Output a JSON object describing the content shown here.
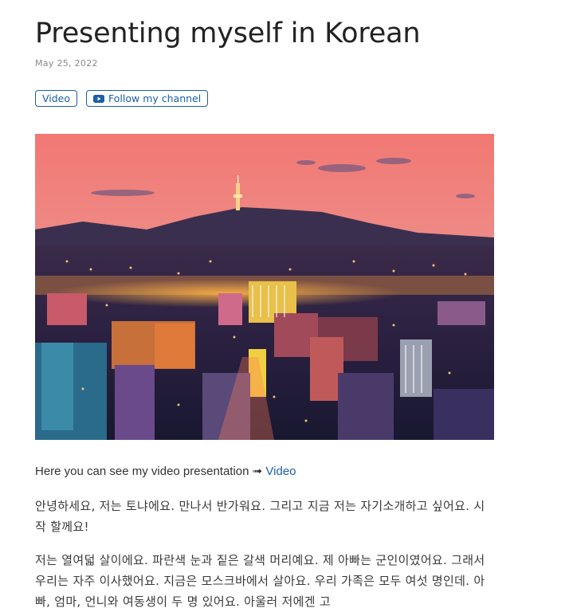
{
  "post": {
    "title": "Presenting myself in Korean",
    "date": "May 25, 2022",
    "tags": {
      "video": "Video",
      "channel": "Follow my channel"
    },
    "intro_text": "Here you can see my video presentation",
    "intro_arrow": "➟",
    "intro_link": "Video",
    "paragraphs": [
      "안녕하세요, 저는 토냐에요. 만나서 반가워요. 그리고 지금 저는 자기소개하고 싶어요. 시작 할께요!",
      "저는 열여덟 살이에요. 파란색 눈과 짙은 갈색 머리예요. 제 아빠는 군인이였어요. 그래서 우리는 자주 이사했어요. 지금은 모스크바에서 살아요. 우리 가족은 모두 여섯 명인데. 아빠, 엄마, 언니와 여동생이 두 명 있어요. 아울러 저에겐 고"
    ]
  },
  "colors": {
    "link": "#1a5fa8",
    "youtube": "#1a5fa8",
    "sky_top": "#f07a7a",
    "sky_bottom": "#d98a9a"
  },
  "icons": {
    "channel_tag": "youtube-icon"
  }
}
